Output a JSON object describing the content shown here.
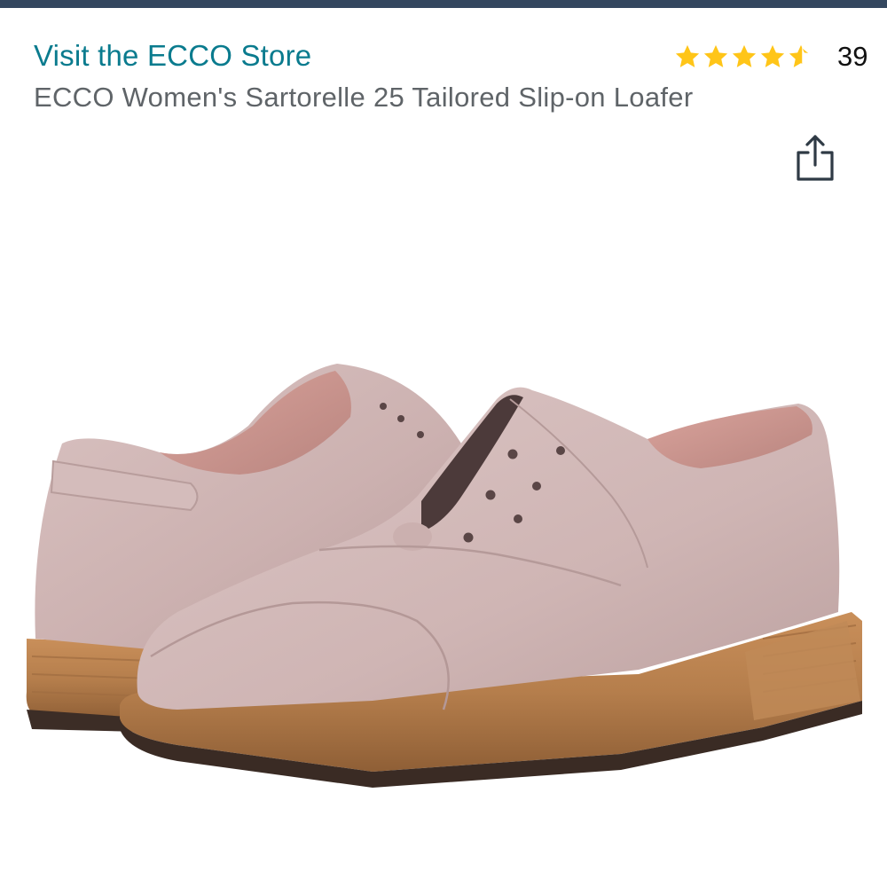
{
  "store": {
    "link_label": "Visit the ECCO Store"
  },
  "product": {
    "title": "ECCO Women's Sartorelle 25 Tailored Slip-on Loafer",
    "rating_value": 4.5,
    "rating_max": 5,
    "rating_count": "39",
    "image_icon": "product-photo-suede-loafers"
  },
  "icons": {
    "share": "share-icon",
    "star": "star-icon"
  },
  "colors": {
    "top_bar": "#34475f",
    "store_link": "#0a7b8e",
    "title": "#5f6468",
    "star": "#ffc518",
    "suede": "#d2b8b8",
    "sole": "#b57e4c"
  }
}
